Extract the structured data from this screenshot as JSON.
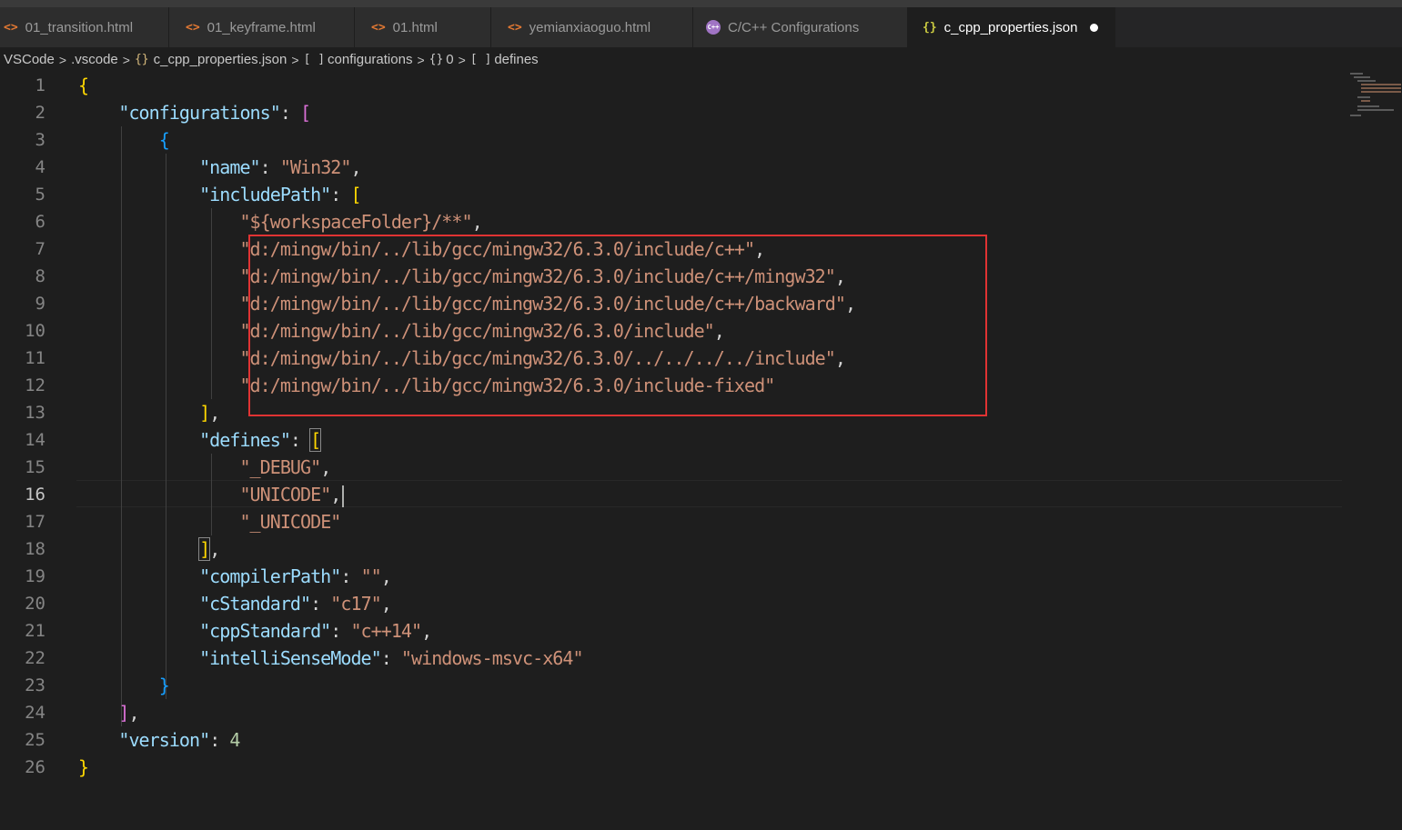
{
  "tabs": [
    {
      "label": "01_transition.html",
      "icon": "html-icon",
      "icon_glyph": "<>"
    },
    {
      "label": "01_keyframe.html",
      "icon": "html-icon",
      "icon_glyph": "<>"
    },
    {
      "label": "01.html",
      "icon": "html-icon",
      "icon_glyph": "<>"
    },
    {
      "label": "yemianxiaoguo.html",
      "icon": "html-icon",
      "icon_glyph": "<>"
    },
    {
      "label": "C/C++ Configurations",
      "icon": "cpp-icon",
      "icon_glyph": "C++"
    },
    {
      "label": "c_cpp_properties.json",
      "icon": "json-icon",
      "icon_glyph": "{}",
      "active": true,
      "unsaved": true
    }
  ],
  "breadcrumb": {
    "items": [
      "VSCode",
      ".vscode",
      "c_cpp_properties.json",
      "configurations",
      "0",
      "defines"
    ],
    "item_icons": [
      "",
      "",
      "{}",
      "[ ]",
      "{}",
      "[ ]"
    ],
    "separator": ">"
  },
  "editor": {
    "current_line": 16,
    "line_numbers": [
      "1",
      "2",
      "3",
      "4",
      "5",
      "6",
      "7",
      "8",
      "9",
      "10",
      "11",
      "12",
      "13",
      "14",
      "15",
      "16",
      "17",
      "18",
      "19",
      "20",
      "21",
      "22",
      "23",
      "24",
      "25",
      "26"
    ],
    "tokens": {
      "open_brace": "{",
      "close_brace": "}",
      "open_bracket": "[",
      "close_bracket": "]",
      "close_bracket_comma": "],",
      "close_brace_only": "}",
      "colon": ": ",
      "comma": ",",
      "k_configurations": "\"configurations\"",
      "k_name": "\"name\"",
      "v_name": "\"Win32\"",
      "k_includePath": "\"includePath\"",
      "inc_0": "\"${workspaceFolder}/**\"",
      "inc_1": "\"d:/mingw/bin/../lib/gcc/mingw32/6.3.0/include/c++\"",
      "inc_2": "\"d:/mingw/bin/../lib/gcc/mingw32/6.3.0/include/c++/mingw32\"",
      "inc_3": "\"d:/mingw/bin/../lib/gcc/mingw32/6.3.0/include/c++/backward\"",
      "inc_4": "\"d:/mingw/bin/../lib/gcc/mingw32/6.3.0/include\"",
      "inc_5": "\"d:/mingw/bin/../lib/gcc/mingw32/6.3.0/../../../../include\"",
      "inc_6": "\"d:/mingw/bin/../lib/gcc/mingw32/6.3.0/include-fixed\"",
      "k_defines": "\"defines\"",
      "def_0": "\"_DEBUG\"",
      "def_1": "\"UNICODE\"",
      "def_2": "\"_UNICODE\"",
      "k_compilerPath": "\"compilerPath\"",
      "v_compilerPath": "\"\"",
      "k_cStandard": "\"cStandard\"",
      "v_cStandard": "\"c17\"",
      "k_cppStandard": "\"cppStandard\"",
      "v_cppStandard": "\"c++14\"",
      "k_intelliSenseMode": "\"intelliSenseMode\"",
      "v_intelliSenseMode": "\"windows-msvc-x64\"",
      "k_version": "\"version\"",
      "v_version": "4"
    }
  },
  "colors": {
    "background": "#1e1e1e",
    "key": "#9cdcfe",
    "string": "#ce9178",
    "number": "#b5cea8",
    "bracket_level1": "#ffd700",
    "bracket_level2": "#da70d6",
    "bracket_level3": "#179fff",
    "highlight_box": "#e03333"
  }
}
